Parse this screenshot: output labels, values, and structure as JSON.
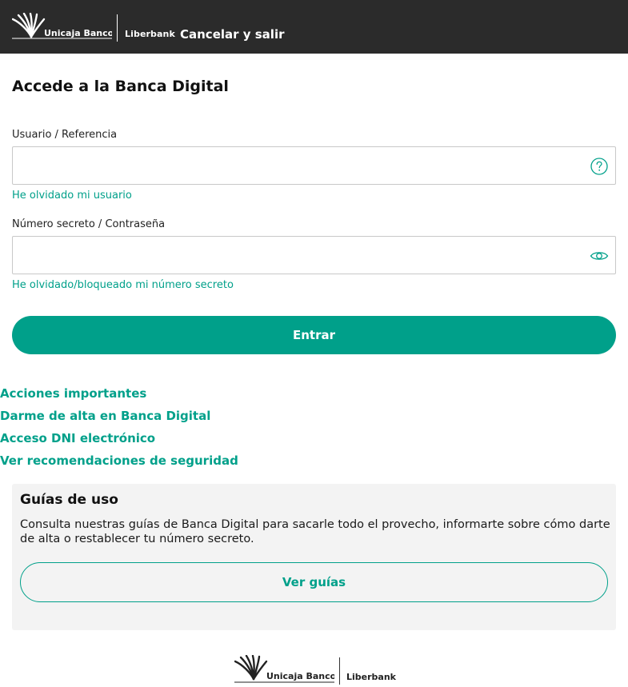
{
  "header": {
    "logo_primary": "Unicaja Banco",
    "logo_secondary": "Liberbank",
    "cancel_label": "Cancelar y salir"
  },
  "login": {
    "title": "Accede a la Banca Digital",
    "username": {
      "label": "Usuario / Referencia",
      "value": "",
      "placeholder": "",
      "icon": "question-circle-icon",
      "forgot_link": "He olvidado mi usuario"
    },
    "password": {
      "label": "Número secreto / Contraseña",
      "value": "",
      "placeholder": "",
      "icon": "eye-icon",
      "forgot_link": "He olvidado/bloqueado mi número secreto"
    },
    "submit_label": "Entrar"
  },
  "links": [
    "Acciones importantes",
    "Darme de alta en Banca Digital",
    "Acceso DNI electrónico",
    "Ver recomendaciones de seguridad"
  ],
  "guides": {
    "title": "Guías de uso",
    "text": "Consulta nuestras guías de Banca Digital para sacarle todo el provecho, informarte sobre cómo darte de alta o restablecer tu número secreto.",
    "button_label": "Ver guías"
  },
  "footer": {
    "logo_primary": "Unicaja Banco",
    "logo_secondary": "Liberbank"
  },
  "colors": {
    "header_bg": "#2b2b2b",
    "accent": "#00a08a",
    "card_bg": "#f3f3f3"
  }
}
